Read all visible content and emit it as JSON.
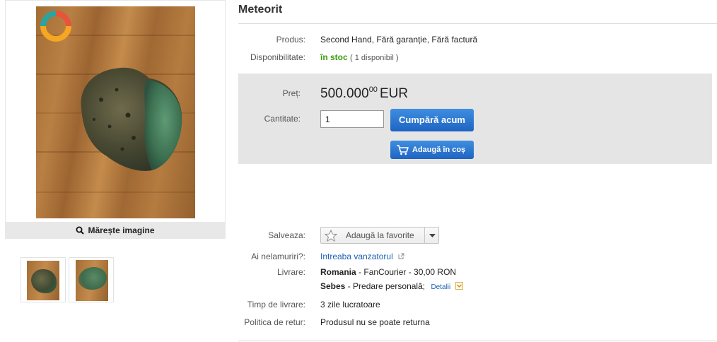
{
  "gallery": {
    "zoom_label": "Mărește imagine",
    "thumbnails": [
      "thumbnail-1",
      "thumbnail-2"
    ]
  },
  "product": {
    "title": "Meteorit",
    "condition_label": "Produs:",
    "condition_value": "Second Hand, Fără garanție, Fără factură",
    "availability_label": "Disponibilitate:",
    "availability_value": "în stoc",
    "availability_count": "( 1 disponibil )"
  },
  "buybox": {
    "price_label": "Preț:",
    "price_integer": "500.000",
    "price_decimals": "00",
    "currency": "EUR",
    "quantity_label": "Cantitate:",
    "quantity_value": "1",
    "buy_now_label": "Cumpără acum",
    "add_to_cart_label": "Adaugă în coș"
  },
  "info": {
    "save_label": "Salveaza:",
    "favorites_label": "Adaugă la favorite",
    "questions_label": "Ai nelamuriri?:",
    "ask_seller_link": "Intreaba vanzatorul",
    "delivery_label": "Livrare:",
    "delivery_1_place": "Romania",
    "delivery_1_detail": "- FanCourier - 30,00 RON",
    "delivery_2_place": "Sebes",
    "delivery_2_detail": "- Predare personală;",
    "delivery_details_link": "Detalii",
    "delivery_time_label": "Timp de livrare:",
    "delivery_time_value": "3 zile lucratoare",
    "return_policy_label": "Politica de retur:",
    "return_policy_value": "Produsul nu se poate returna"
  },
  "colors": {
    "accent_blue": "#1f64c2",
    "in_stock_green": "#3a9b0a",
    "buybox_bg": "#e5e5e5"
  },
  "icons": [
    "magnifier-icon",
    "cart-icon",
    "star-icon",
    "chevron-down-icon",
    "external-link-icon",
    "logo-ring"
  ]
}
